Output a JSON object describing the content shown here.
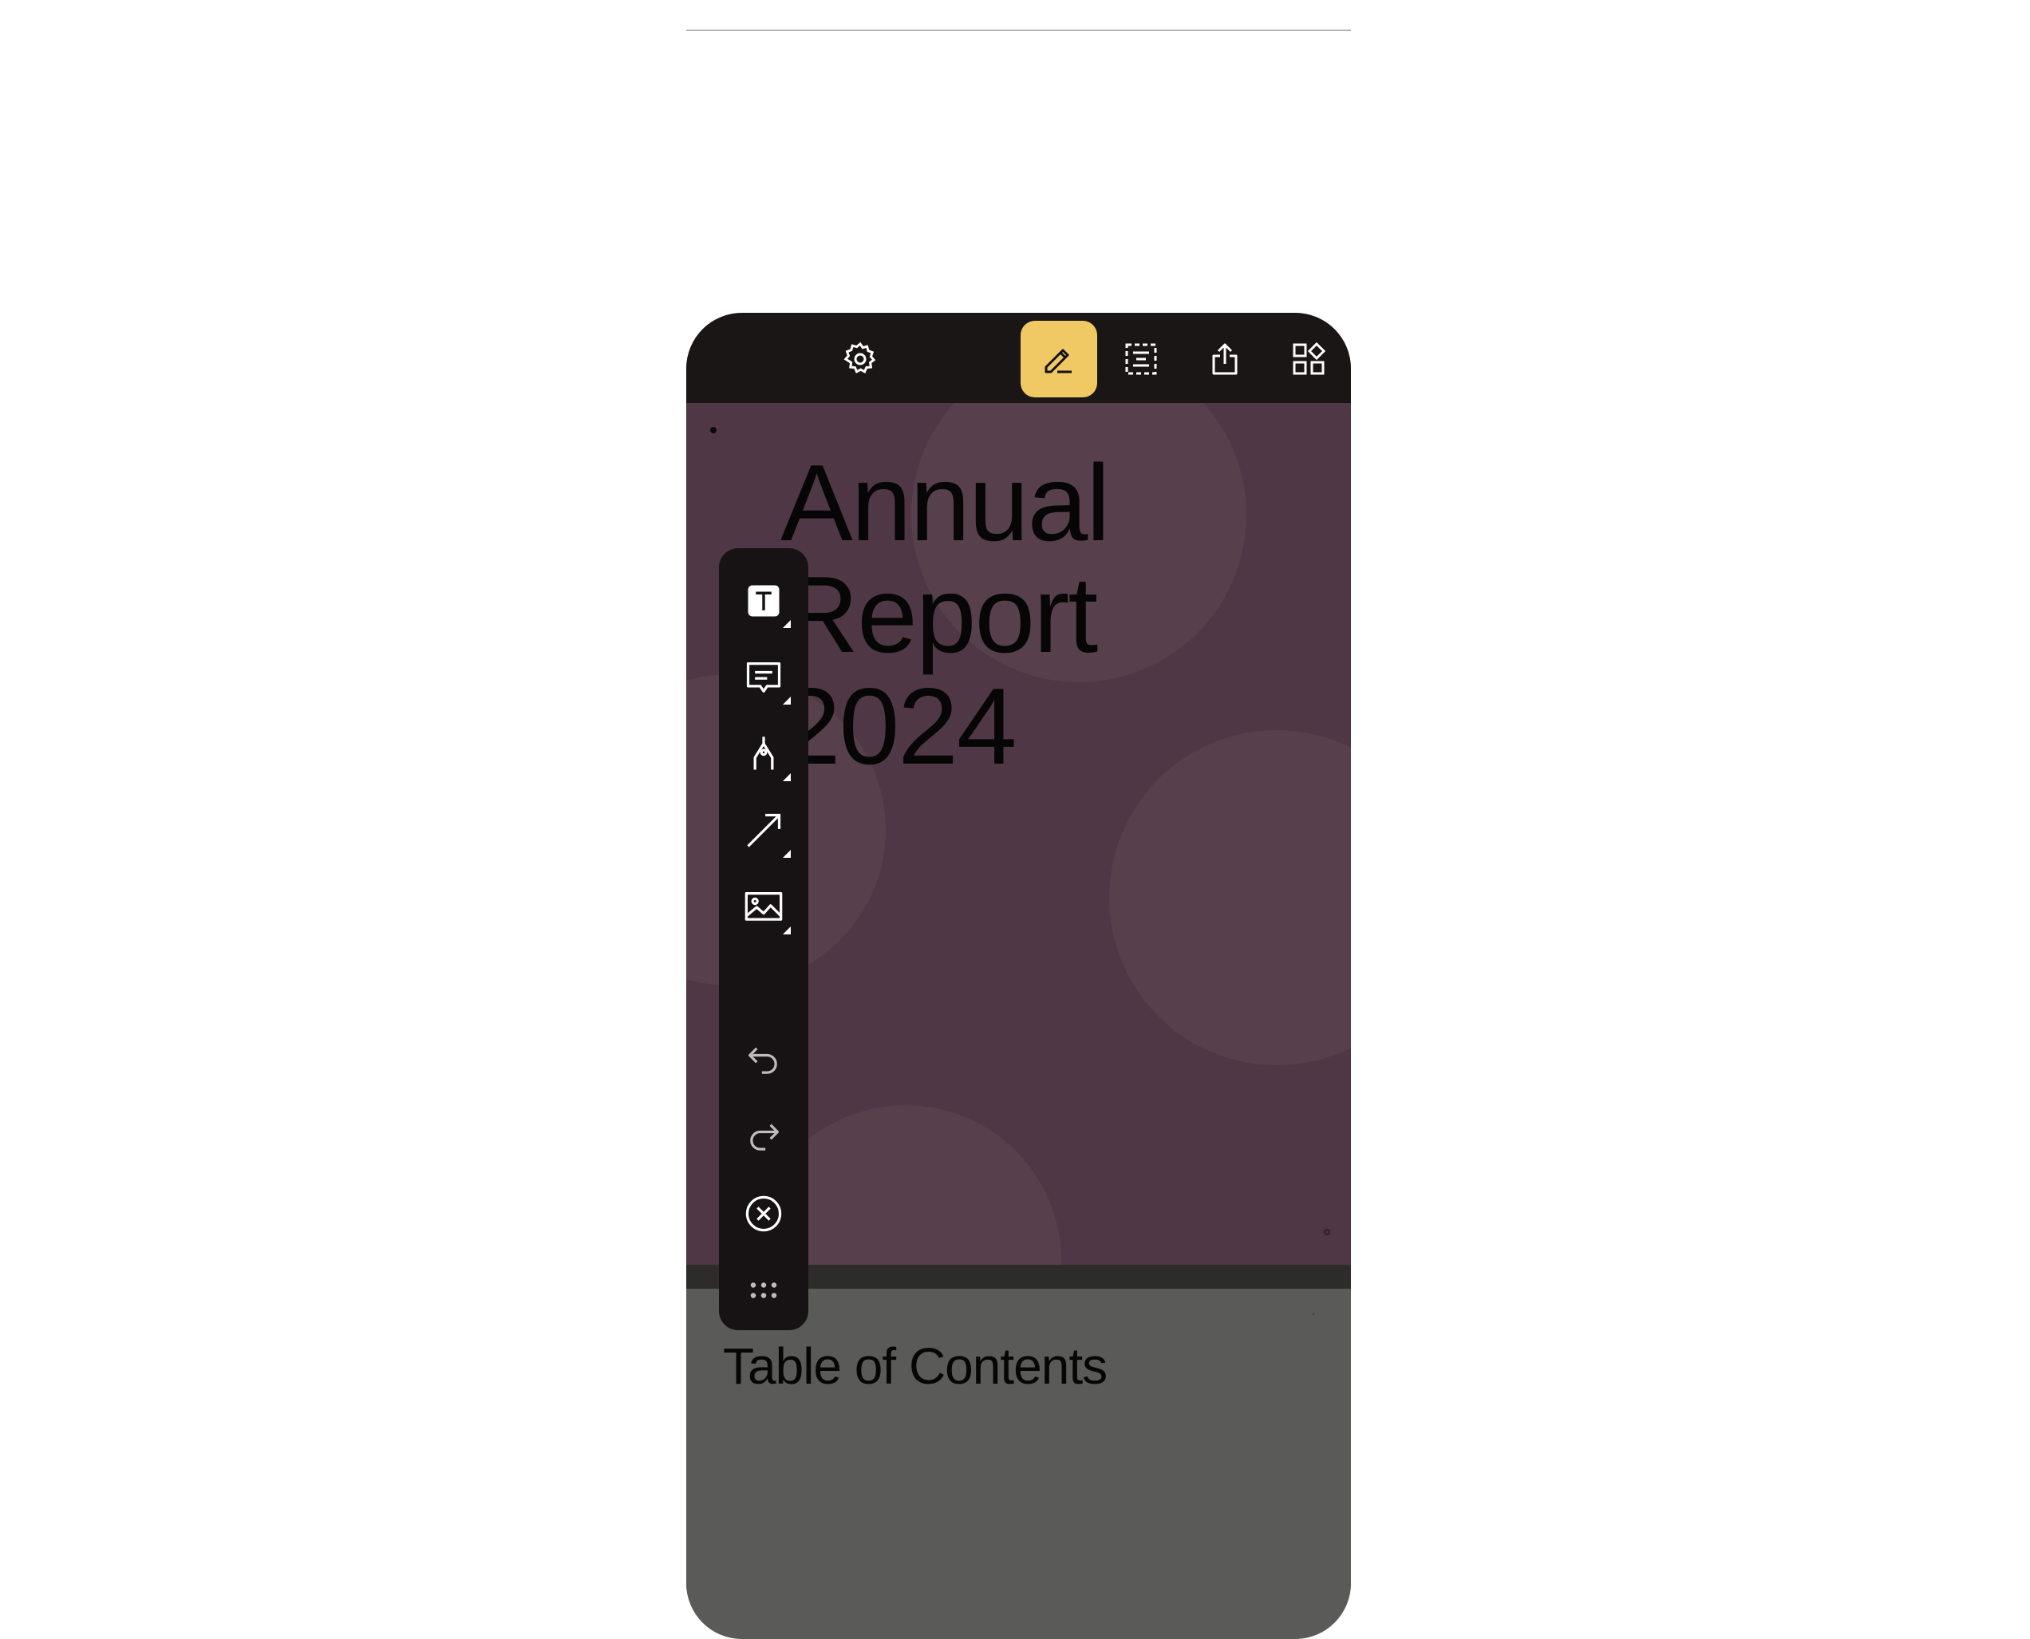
{
  "toolbar": {
    "items": [
      {
        "icon": "gear-icon",
        "label": "Settings"
      },
      {
        "icon": "pencil-icon",
        "label": "Annotate",
        "active": true
      },
      {
        "icon": "text-selection-icon",
        "label": "Text selection"
      },
      {
        "icon": "share-icon",
        "label": "Share"
      },
      {
        "icon": "thumbnails-icon",
        "label": "Thumbnails"
      }
    ],
    "active_color": "#f0c965",
    "background": "#1b1616"
  },
  "document": {
    "cover": {
      "title_lines": [
        "Annual",
        "Report",
        "2024"
      ],
      "background": "#4f3745"
    },
    "second_page": {
      "heading": "Table of Contents",
      "background": "#5a5a58"
    }
  },
  "annotation_tools": [
    {
      "icon": "text-tool-icon",
      "has_submenu": true
    },
    {
      "icon": "comment-icon",
      "has_submenu": true
    },
    {
      "icon": "pen-tool-icon",
      "has_submenu": true
    },
    {
      "icon": "line-arrow-icon",
      "has_submenu": true
    },
    {
      "icon": "image-icon",
      "has_submenu": true
    },
    {
      "icon": "undo-icon",
      "has_submenu": false
    },
    {
      "icon": "redo-icon",
      "has_submenu": false
    },
    {
      "icon": "close-icon",
      "has_submenu": false
    },
    {
      "icon": "drag-handle-icon",
      "has_submenu": false
    }
  ]
}
